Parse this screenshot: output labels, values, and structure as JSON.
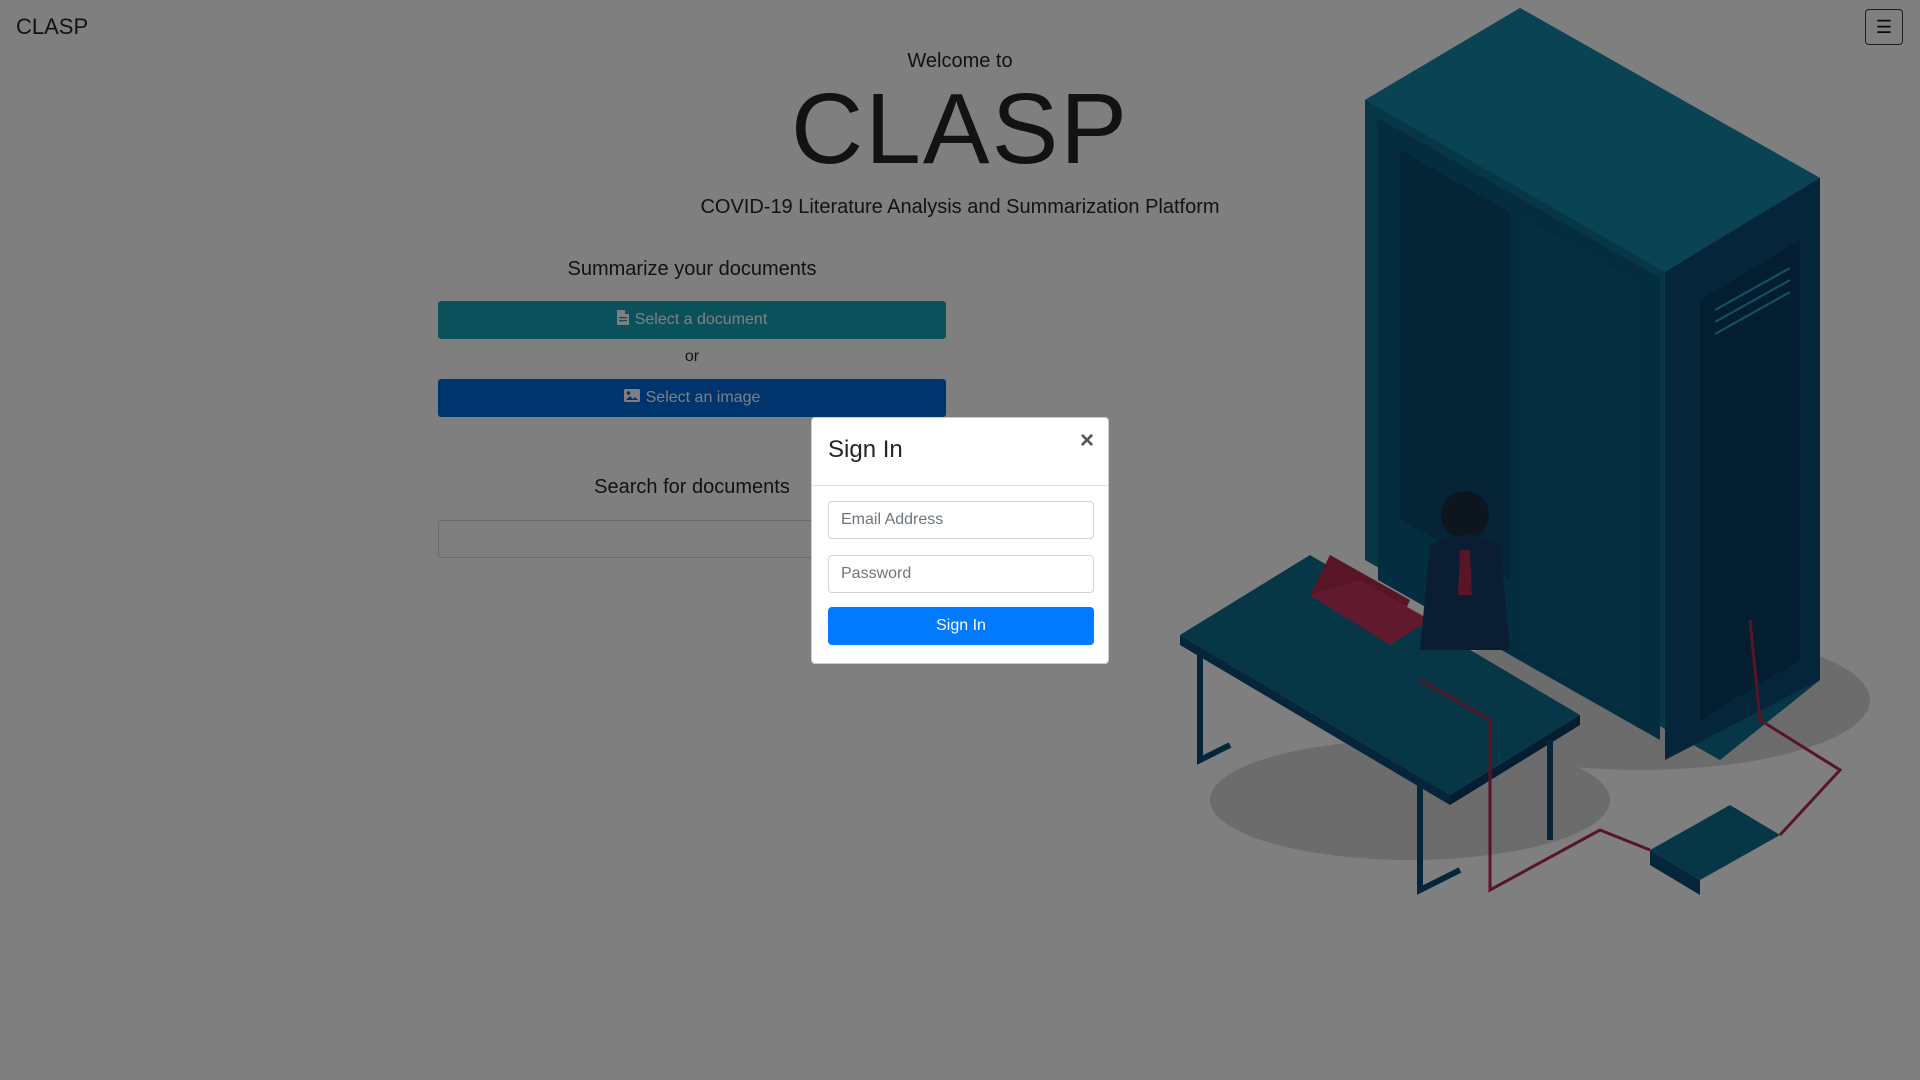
{
  "nav": {
    "brand": "CLASP",
    "menu_icon": "hamburger-menu-icon"
  },
  "hero": {
    "welcome": "Welcome to",
    "title": "CLASP",
    "tagline": "COVID-19 Literature Analysis and Summarization Platform"
  },
  "summarize": {
    "heading": "Summarize your documents",
    "doc_button": "Select a document",
    "doc_icon": "file-document-icon",
    "or": "or",
    "image_button": "Select an image",
    "image_icon": "image-icon"
  },
  "search": {
    "heading": "Search for documents",
    "placeholder": ""
  },
  "modal": {
    "title": "Sign In",
    "close": "×",
    "email_placeholder": "Email Address",
    "password_placeholder": "Password",
    "submit": "Sign In"
  },
  "colors": {
    "teal": "#17a2b8",
    "blue": "#0069d9",
    "primary": "#007bff",
    "illustration_blue": "#0b6d8c"
  }
}
